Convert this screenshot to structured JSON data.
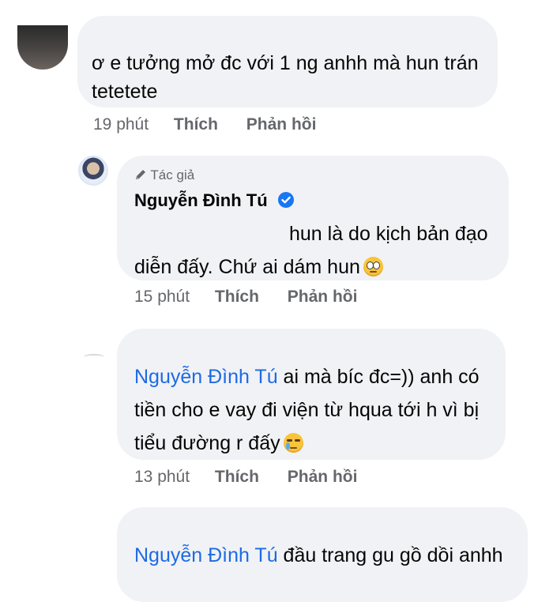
{
  "comments": [
    {
      "text_line1": "ơ e tưởng mở đc với 1 ng anhh mà hun trán",
      "text_line2": "tetetete",
      "time": "19 phút",
      "like_label": "Thích",
      "reply_label": "Phản hồi"
    },
    {
      "badge_label": "Tác giả",
      "author": "Nguyễn Đình Tú",
      "text_line1": "hun là do kịch bản đạo",
      "text_line2": "diễn đấy. Chứ ai dám hun",
      "emoji": "face-with-rolling-eyes",
      "time": "15 phút",
      "like_label": "Thích",
      "reply_label": "Phản hồi"
    },
    {
      "mention": "Nguyễn Đình Tú",
      "text_line1": " ai mà bíc đc=)) anh có",
      "text_line2": "tiền cho e vay đi viện từ hqua tới h vì bị",
      "text_line3": "tiểu đường r đấy",
      "emoji": "crying-face",
      "time": "13 phút",
      "like_label": "Thích",
      "reply_label": "Phản hồi"
    },
    {
      "mention": "Nguyễn Đình Tú",
      "text_line1": " đầu trang gu gồ dồi anhh"
    }
  ],
  "colors": {
    "bubble_bg": "#f0f2f5",
    "mention": "#1d6ae5",
    "meta": "#65676b",
    "verified": "#1877f2"
  },
  "icons": {
    "author_badge": "pen-icon",
    "verified": "verified-check-icon"
  }
}
